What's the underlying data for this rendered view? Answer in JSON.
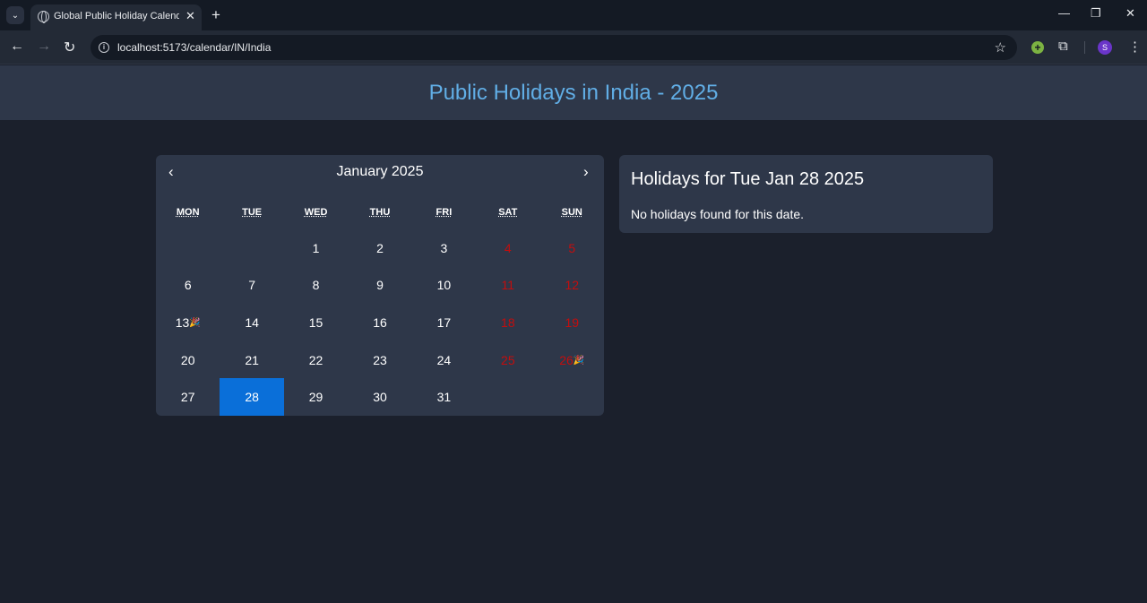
{
  "browser": {
    "tab_title": "Global Public Holiday Calendar",
    "url": "localhost:5173/calendar/IN/India",
    "profile_initial": "S"
  },
  "header": {
    "title": "Public Holidays in India - 2025"
  },
  "calendar": {
    "prev_label": "‹",
    "next_label": "›",
    "month_label": "January 2025",
    "weekdays": [
      "MON",
      "TUE",
      "WED",
      "THU",
      "FRI",
      "SAT",
      "SUN"
    ],
    "leading_blanks": 2,
    "days_in_month": 31,
    "selected_day": 28,
    "holiday_days": [
      13,
      26
    ],
    "weekend_color": "#c40d0d",
    "selected_color": "#0a6fd9",
    "holiday_marker_icon": "party-popper-icon"
  },
  "holiday_panel": {
    "title": "Holidays for Tue Jan 28 2025",
    "message": "No holidays found for this date."
  },
  "colors": {
    "accent": "#61aee6",
    "panel_bg": "#2e3749",
    "page_bg": "#1b202c"
  }
}
